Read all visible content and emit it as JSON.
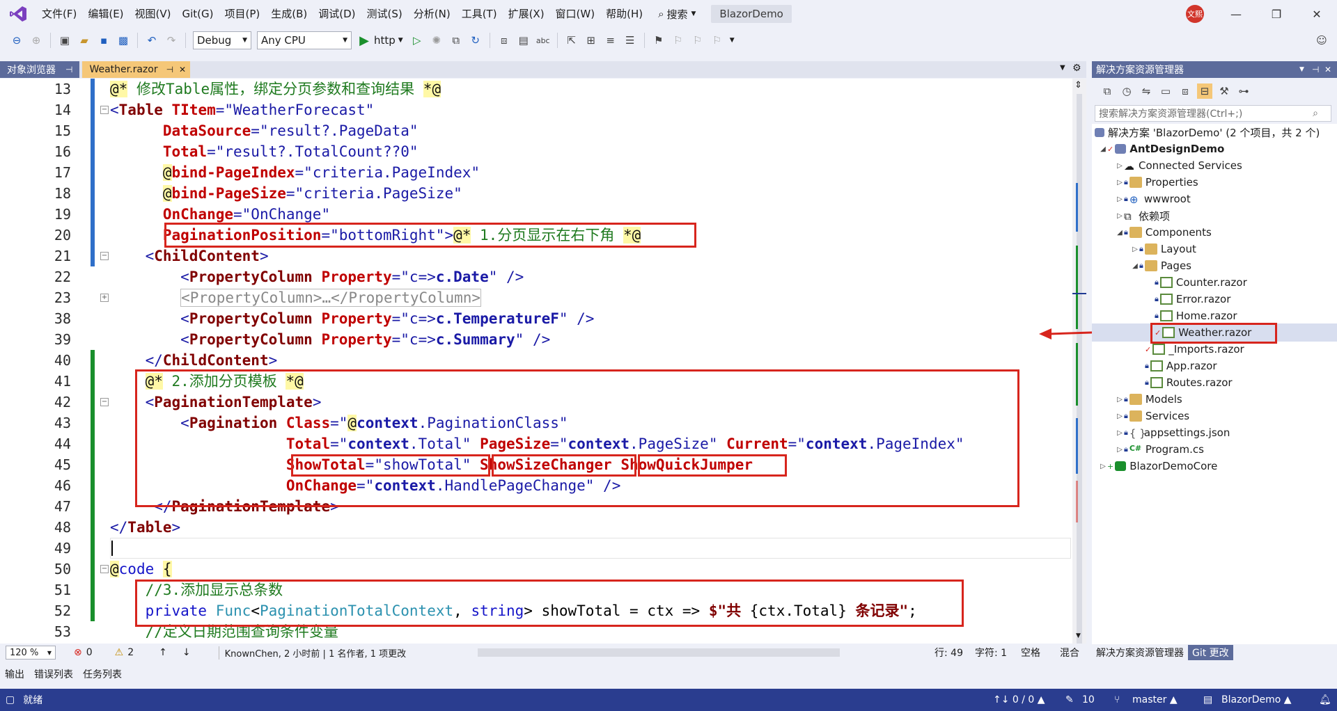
{
  "menubar": {
    "items": [
      "文件(F)",
      "编辑(E)",
      "视图(V)",
      "Git(G)",
      "项目(P)",
      "生成(B)",
      "调试(D)",
      "测试(S)",
      "分析(N)",
      "工具(T)",
      "扩展(X)",
      "窗口(W)",
      "帮助(H)"
    ],
    "search_label": "搜索",
    "solution_title": "BlazorDemo",
    "avatar_text": "文熙"
  },
  "toolbar": {
    "config": "Debug",
    "platform": "Any CPU",
    "run_label": "http"
  },
  "tabs": {
    "object_browser": "对象浏览器",
    "file_tab": "Weather.razor",
    "pin_glyph": "ᵖ",
    "close_glyph": "✕"
  },
  "editor": {
    "line_numbers": [
      "13",
      "14",
      "15",
      "16",
      "17",
      "18",
      "19",
      "20",
      "21",
      "22",
      "23",
      "38",
      "39",
      "40",
      "41",
      "42",
      "43",
      "44",
      "45",
      "46",
      "47",
      "48",
      "49",
      "50",
      "51",
      "52",
      "53"
    ],
    "lines": [
      {
        "segs": [
          {
            "c": "at",
            "t": "@*"
          },
          {
            "c": "cm",
            "t": " 修改Table属性，绑定分页参数和查询结果 "
          },
          {
            "c": "at",
            "t": "*@"
          }
        ]
      },
      {
        "segs": [
          {
            "c": "s",
            "t": "<"
          },
          {
            "c": "t",
            "t": "Table"
          },
          {
            "c": "blk",
            "t": " "
          },
          {
            "c": "a",
            "t": "TItem"
          },
          {
            "c": "s",
            "t": "=\"WeatherForecast\""
          }
        ]
      },
      {
        "segs": [
          {
            "c": "blk",
            "t": "      "
          },
          {
            "c": "a",
            "t": "DataSource"
          },
          {
            "c": "s",
            "t": "=\"result?.PageData\""
          }
        ]
      },
      {
        "segs": [
          {
            "c": "blk",
            "t": "      "
          },
          {
            "c": "a",
            "t": "Total"
          },
          {
            "c": "s",
            "t": "=\"result?.TotalCount??0\""
          }
        ]
      },
      {
        "segs": [
          {
            "c": "blk",
            "t": "      "
          },
          {
            "c": "at",
            "t": "@"
          },
          {
            "c": "a",
            "t": "bind-PageIndex"
          },
          {
            "c": "s",
            "t": "=\"criteria.PageIndex\""
          }
        ]
      },
      {
        "segs": [
          {
            "c": "blk",
            "t": "      "
          },
          {
            "c": "at",
            "t": "@"
          },
          {
            "c": "a",
            "t": "bind-PageSize"
          },
          {
            "c": "s",
            "t": "=\"criteria.PageSize\""
          }
        ]
      },
      {
        "segs": [
          {
            "c": "blk",
            "t": "      "
          },
          {
            "c": "a",
            "t": "OnChange"
          },
          {
            "c": "s",
            "t": "=\"OnChange\""
          }
        ]
      },
      {
        "segs": [
          {
            "c": "blk",
            "t": "      "
          },
          {
            "c": "a",
            "t": "PaginationPosition"
          },
          {
            "c": "s",
            "t": "=\"bottomRight\">"
          },
          {
            "c": "at",
            "t": "@*"
          },
          {
            "c": "cm",
            "t": " 1.分页显示在右下角 "
          },
          {
            "c": "at",
            "t": "*@"
          }
        ]
      },
      {
        "segs": [
          {
            "c": "blk",
            "t": "    "
          },
          {
            "c": "s",
            "t": "<"
          },
          {
            "c": "t",
            "t": "ChildContent"
          },
          {
            "c": "s",
            "t": ">"
          }
        ]
      },
      {
        "segs": [
          {
            "c": "blk",
            "t": "        "
          },
          {
            "c": "s",
            "t": "<"
          },
          {
            "c": "t",
            "t": "PropertyColumn"
          },
          {
            "c": "blk",
            "t": " "
          },
          {
            "c": "a",
            "t": "Property"
          },
          {
            "c": "s",
            "t": "=\"c=>"
          },
          {
            "c": "sb",
            "t": "c.Date"
          },
          {
            "c": "s",
            "t": "\" />"
          }
        ]
      },
      {
        "segs": [
          {
            "c": "blk",
            "t": "        "
          },
          {
            "c": "fold",
            "t": "<PropertyColumn>…</PropertyColumn>"
          }
        ]
      },
      {
        "segs": [
          {
            "c": "blk",
            "t": "        "
          },
          {
            "c": "s",
            "t": "<"
          },
          {
            "c": "t",
            "t": "PropertyColumn"
          },
          {
            "c": "blk",
            "t": " "
          },
          {
            "c": "a",
            "t": "Property"
          },
          {
            "c": "s",
            "t": "=\"c=>"
          },
          {
            "c": "sb",
            "t": "c.TemperatureF"
          },
          {
            "c": "s",
            "t": "\" />"
          }
        ]
      },
      {
        "segs": [
          {
            "c": "blk",
            "t": "        "
          },
          {
            "c": "s",
            "t": "<"
          },
          {
            "c": "t",
            "t": "PropertyColumn"
          },
          {
            "c": "blk",
            "t": " "
          },
          {
            "c": "a",
            "t": "Property"
          },
          {
            "c": "s",
            "t": "=\"c=>"
          },
          {
            "c": "sb",
            "t": "c.Summary"
          },
          {
            "c": "s",
            "t": "\" />"
          }
        ]
      },
      {
        "segs": [
          {
            "c": "blk",
            "t": "    "
          },
          {
            "c": "s",
            "t": "</"
          },
          {
            "c": "t",
            "t": "ChildContent"
          },
          {
            "c": "s",
            "t": ">"
          }
        ]
      },
      {
        "segs": [
          {
            "c": "blk",
            "t": "    "
          },
          {
            "c": "at",
            "t": "@*"
          },
          {
            "c": "cm",
            "t": " 2.添加分页模板 "
          },
          {
            "c": "at",
            "t": "*@"
          }
        ]
      },
      {
        "segs": [
          {
            "c": "blk",
            "t": "    "
          },
          {
            "c": "s",
            "t": "<"
          },
          {
            "c": "t",
            "t": "PaginationTemplate"
          },
          {
            "c": "s",
            "t": ">"
          }
        ]
      },
      {
        "segs": [
          {
            "c": "blk",
            "t": "        "
          },
          {
            "c": "s",
            "t": "<"
          },
          {
            "c": "t",
            "t": "Pagination"
          },
          {
            "c": "blk",
            "t": " "
          },
          {
            "c": "a",
            "t": "Class"
          },
          {
            "c": "s",
            "t": "=\""
          },
          {
            "c": "at",
            "t": "@"
          },
          {
            "c": "sb",
            "t": "context"
          },
          {
            "c": "s",
            "t": ".PaginationClass\""
          }
        ]
      },
      {
        "segs": [
          {
            "c": "blk",
            "t": "                    "
          },
          {
            "c": "a",
            "t": "Total"
          },
          {
            "c": "s",
            "t": "=\""
          },
          {
            "c": "sb",
            "t": "context"
          },
          {
            "c": "s",
            "t": ".Total\" "
          },
          {
            "c": "a",
            "t": "PageSize"
          },
          {
            "c": "s",
            "t": "=\""
          },
          {
            "c": "sb",
            "t": "context"
          },
          {
            "c": "s",
            "t": ".PageSize\" "
          },
          {
            "c": "a",
            "t": "Current"
          },
          {
            "c": "s",
            "t": "=\""
          },
          {
            "c": "sb",
            "t": "context"
          },
          {
            "c": "s",
            "t": ".PageIndex\""
          }
        ]
      },
      {
        "segs": [
          {
            "c": "blk",
            "t": "                    "
          },
          {
            "c": "a",
            "t": "ShowTotal"
          },
          {
            "c": "s",
            "t": "=\"showTotal\" "
          },
          {
            "c": "a",
            "t": "ShowSizeChanger"
          },
          {
            "c": "blk",
            "t": " "
          },
          {
            "c": "a",
            "t": "ShowQuickJumper"
          }
        ]
      },
      {
        "segs": [
          {
            "c": "blk",
            "t": "                    "
          },
          {
            "c": "a",
            "t": "OnChange"
          },
          {
            "c": "s",
            "t": "=\""
          },
          {
            "c": "sb",
            "t": "context"
          },
          {
            "c": "s",
            "t": ".HandlePageChange\" />"
          }
        ]
      },
      {
        "segs": [
          {
            "c": "blk",
            "t": "     "
          },
          {
            "c": "s",
            "t": "</"
          },
          {
            "c": "t",
            "t": "PaginationTemplate"
          },
          {
            "c": "s",
            "t": ">"
          }
        ]
      },
      {
        "segs": [
          {
            "c": "s",
            "t": "</"
          },
          {
            "c": "t",
            "t": "Table"
          },
          {
            "c": "s",
            "t": ">"
          }
        ]
      },
      {
        "segs": [
          {
            "c": "blk",
            "t": ""
          }
        ]
      },
      {
        "segs": [
          {
            "c": "at",
            "t": "@"
          },
          {
            "c": "kw",
            "t": "code"
          },
          {
            "c": "blk",
            "t": " "
          },
          {
            "c": "at",
            "t": "{"
          }
        ]
      },
      {
        "segs": [
          {
            "c": "blk",
            "t": "    "
          },
          {
            "c": "cm",
            "t": "//3.添加显示总条数"
          }
        ]
      },
      {
        "segs": [
          {
            "c": "blk",
            "t": "    "
          },
          {
            "c": "kw",
            "t": "private"
          },
          {
            "c": "blk",
            "t": " "
          },
          {
            "c": "ty",
            "t": "Func"
          },
          {
            "c": "blk",
            "t": "<"
          },
          {
            "c": "ty",
            "t": "PaginationTotalContext"
          },
          {
            "c": "blk",
            "t": ", "
          },
          {
            "c": "kw",
            "t": "string"
          },
          {
            "c": "blk",
            "t": "> showTotal = "
          },
          {
            "c": "blk",
            "t": "ctx => "
          },
          {
            "c": "t",
            "t": "$\"共 "
          },
          {
            "c": "blk",
            "t": "{ctx.Total}"
          },
          {
            "c": "t",
            "t": " 条记录\""
          },
          {
            "c": "blk",
            "t": ";"
          }
        ]
      },
      {
        "segs": [
          {
            "c": "blk",
            "t": "    "
          },
          {
            "c": "cm",
            "t": "//定义日期范围查询条件变量"
          }
        ]
      }
    ]
  },
  "editor_status": {
    "zoom": "120 %",
    "errors": "0",
    "warnings": "2",
    "git_blame": "KnownChen, 2 小时前 | 1 名作者, 1 项更改",
    "line": "行: 49",
    "col": "字符: 1",
    "ws": "空格",
    "eol": "混合"
  },
  "bottom_tabs": [
    "输出",
    "错误列表",
    "任务列表"
  ],
  "statusbar": {
    "ready": "就绪",
    "changes": "↑↓ 0 / 0 ▲",
    "edits": "10",
    "branch": "master ▲",
    "repo": "BlazorDemo ▲"
  },
  "solution_explorer": {
    "title": "解决方案资源管理器",
    "search_placeholder": "搜索解决方案资源管理器(Ctrl+;)",
    "solution_label": "解决方案 'BlazorDemo' (2 个项目，共 2 个)",
    "project": "AntDesignDemo",
    "items": [
      "Connected Services",
      "Properties",
      "wwwroot",
      "依赖项",
      "Components",
      "Layout",
      "Pages",
      "Counter.razor",
      "Error.razor",
      "Home.razor",
      "Weather.razor",
      "_Imports.razor",
      "App.razor",
      "Routes.razor",
      "Models",
      "Services",
      "appsettings.json",
      "Program.cs",
      "BlazorDemoCore"
    ],
    "bottom_tabs": [
      "解决方案资源管理器",
      "Git 更改"
    ]
  }
}
